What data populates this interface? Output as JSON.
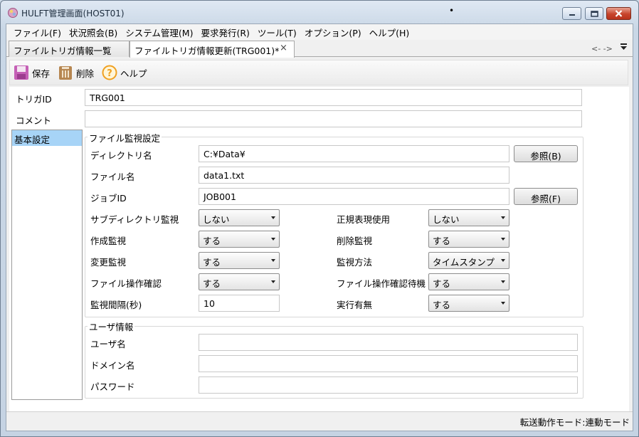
{
  "window": {
    "title": "HULFT管理画面(HOST01)",
    "dot": "•"
  },
  "menu": [
    "ファイル(F)",
    "状況照会(B)",
    "システム管理(M)",
    "要求発行(R)",
    "ツール(T)",
    "オプション(P)",
    "ヘルプ(H)"
  ],
  "tabs": {
    "list_label": "ファイルトリガ情報一覧",
    "update_label": "ファイルトリガ情報更新(TRG001)*",
    "close_glyph": "×",
    "nav": "<- ->"
  },
  "toolbar": {
    "save": "保存",
    "delete": "削除",
    "help": "ヘルプ"
  },
  "form": {
    "trigger_id_label": "トリガID",
    "trigger_id_value": "TRG001",
    "comment_label": "コメント",
    "comment_value": "",
    "side_item": "基本設定",
    "watch_group": "ファイル監視設定",
    "dir_label": "ディレクトリ名",
    "dir_value": "C:¥Data¥",
    "browse_b": "参照(B)",
    "file_label": "ファイル名",
    "file_value": "data1.txt",
    "job_label": "ジョブID",
    "job_value": "JOB001",
    "browse_f": "参照(F)",
    "subdir_label": "サブディレクトリ監視",
    "subdir_value": "しない",
    "regex_label": "正規表現使用",
    "regex_value": "しない",
    "create_label": "作成監視",
    "create_value": "する",
    "delete_label": "削除監視",
    "delete_value": "する",
    "change_label": "変更監視",
    "change_value": "する",
    "method_label": "監視方法",
    "method_value": "タイムスタンプ",
    "fileop_label": "ファイル操作確認",
    "fileop_value": "する",
    "fileopwait_label": "ファイル操作確認待機",
    "fileopwait_value": "する",
    "interval_label": "監視間隔(秒)",
    "interval_value": "10",
    "exec_label": "実行有無",
    "exec_value": "する",
    "user_group": "ユーザ情報",
    "user_label": "ユーザ名",
    "user_value": "",
    "domain_label": "ドメイン名",
    "domain_value": "",
    "password_label": "パスワード",
    "password_value": ""
  },
  "status": {
    "mode": "転送動作モード:連動モード"
  },
  "colors": {
    "selection": "#a7d4f7",
    "close_button": "#c7442b",
    "save_icon": "#c05bb8",
    "help_icon": "#f0a020"
  }
}
